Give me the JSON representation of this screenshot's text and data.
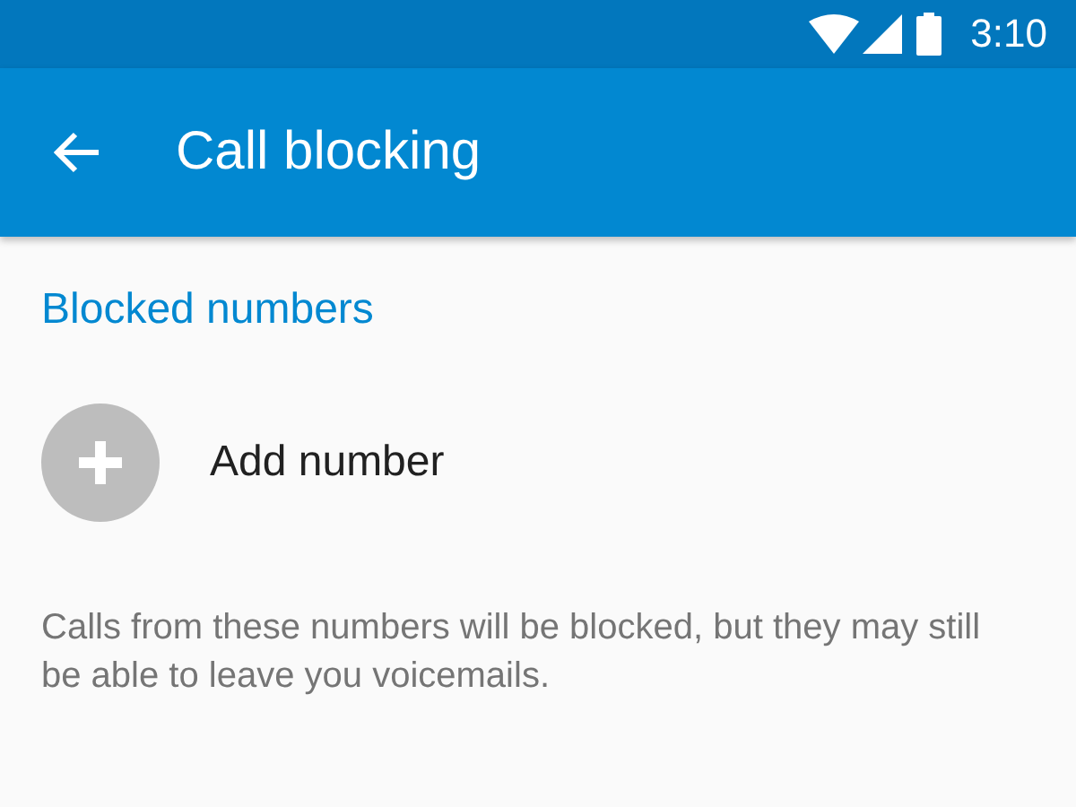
{
  "status_bar": {
    "time": "3:10"
  },
  "app_bar": {
    "title": "Call blocking"
  },
  "section": {
    "header": "Blocked numbers"
  },
  "add_item": {
    "label": "Add number"
  },
  "description": "Calls from these numbers will be blocked, but they may still be able to leave you voicemails."
}
